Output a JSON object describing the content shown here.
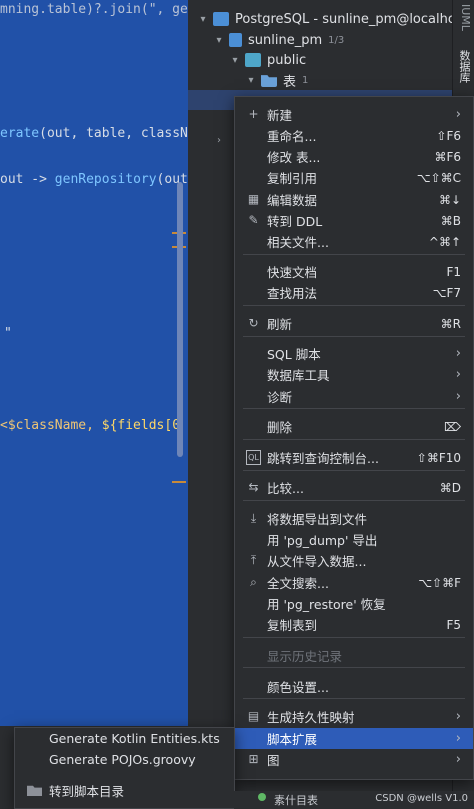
{
  "editor": {
    "lines": [
      {
        "prefix": "",
        "fn": "erate",
        "rest": "(out, table, classN"
      },
      {
        "prefix": "out -> ",
        "fn": "genRepository",
        "rest": "(out"
      },
      {
        "prefix": "\"",
        "fn": "",
        "rest": ""
      },
      {
        "prefix": "<$className, ",
        "fn": "",
        "rest": "${fields[0"
      }
    ]
  },
  "tree": {
    "connection": "PostgreSQL - sunline_pm@localho",
    "database": "sunline_pm",
    "database_badge": "1/3",
    "schema": "public",
    "tables_label": "表",
    "tables_badge": "1"
  },
  "right_strip": {
    "label": "数据库",
    "label2": "IUML"
  },
  "menu": {
    "items": [
      {
        "icon": "+",
        "label": "新建",
        "shortcut": "",
        "submenu": true
      },
      {
        "icon": "",
        "label": "重命名...",
        "shortcut": "⇧F6",
        "submenu": false
      },
      {
        "icon": "",
        "label": "修改 表...",
        "shortcut": "⌘F6",
        "submenu": false
      },
      {
        "icon": "",
        "label": "复制引用",
        "shortcut": "⌥⇧⌘C",
        "submenu": false
      },
      {
        "icon": "▦",
        "label": "编辑数据",
        "shortcut": "⌘↓",
        "submenu": false
      },
      {
        "icon": "✎",
        "label": "转到 DDL",
        "shortcut": "⌘B",
        "submenu": false
      },
      {
        "icon": "",
        "label": "相关文件...",
        "shortcut": "^⌘↑",
        "submenu": false
      },
      {
        "icon": "",
        "label": "快速文档",
        "shortcut": "F1",
        "submenu": false
      },
      {
        "icon": "",
        "label": "查找用法",
        "shortcut": "⌥F7",
        "submenu": false
      },
      {
        "icon": "↻",
        "label": "刷新",
        "shortcut": "⌘R",
        "submenu": false
      },
      {
        "icon": "",
        "label": "SQL 脚本",
        "shortcut": "",
        "submenu": true
      },
      {
        "icon": "",
        "label": "数据库工具",
        "shortcut": "",
        "submenu": true
      },
      {
        "icon": "",
        "label": "诊断",
        "shortcut": "",
        "submenu": true
      },
      {
        "icon": "",
        "label": "删除",
        "shortcut": "⌦",
        "submenu": false
      },
      {
        "icon": "QL",
        "label": "跳转到查询控制台...",
        "shortcut": "⇧⌘F10",
        "submenu": false
      },
      {
        "icon": "⇆",
        "label": "比较...",
        "shortcut": "⌘D",
        "submenu": false
      },
      {
        "icon": "⤓",
        "label": "将数据导出到文件",
        "shortcut": "",
        "submenu": false
      },
      {
        "icon": "",
        "label": "用 'pg_dump' 导出",
        "shortcut": "",
        "submenu": false
      },
      {
        "icon": "⤒",
        "label": "从文件导入数据...",
        "shortcut": "",
        "submenu": false
      },
      {
        "icon": "⌕",
        "label": "全文搜索...",
        "shortcut": "⌥⇧⌘F",
        "submenu": false
      },
      {
        "icon": "",
        "label": "用 'pg_restore' 恢复",
        "shortcut": "",
        "submenu": false
      },
      {
        "icon": "",
        "label": "复制表到",
        "shortcut": "F5",
        "submenu": false
      },
      {
        "icon": "",
        "label": "显示历史记录",
        "shortcut": "",
        "submenu": false
      },
      {
        "icon": "",
        "label": "颜色设置...",
        "shortcut": "",
        "submenu": false
      },
      {
        "icon": "▤",
        "label": "生成持久性映射",
        "shortcut": "",
        "submenu": true
      },
      {
        "icon": "",
        "label": "脚本扩展",
        "shortcut": "",
        "submenu": true
      },
      {
        "icon": "⊞",
        "label": "图",
        "shortcut": "",
        "submenu": true
      }
    ]
  },
  "submenu": {
    "items": [
      {
        "label": "Generate Kotlin Entities.kts"
      },
      {
        "label": "Generate POJOs.groovy"
      },
      {
        "label": "转到脚本目录"
      }
    ]
  },
  "status": {
    "bottom_text": "素什目表",
    "watermark": "CSDN @wells V1.0"
  },
  "colors": {
    "editor_bg": "#2151a8",
    "panel_bg": "#2b2d30",
    "active_item": "#2e5cb8",
    "selected_row": "#2e436e"
  }
}
